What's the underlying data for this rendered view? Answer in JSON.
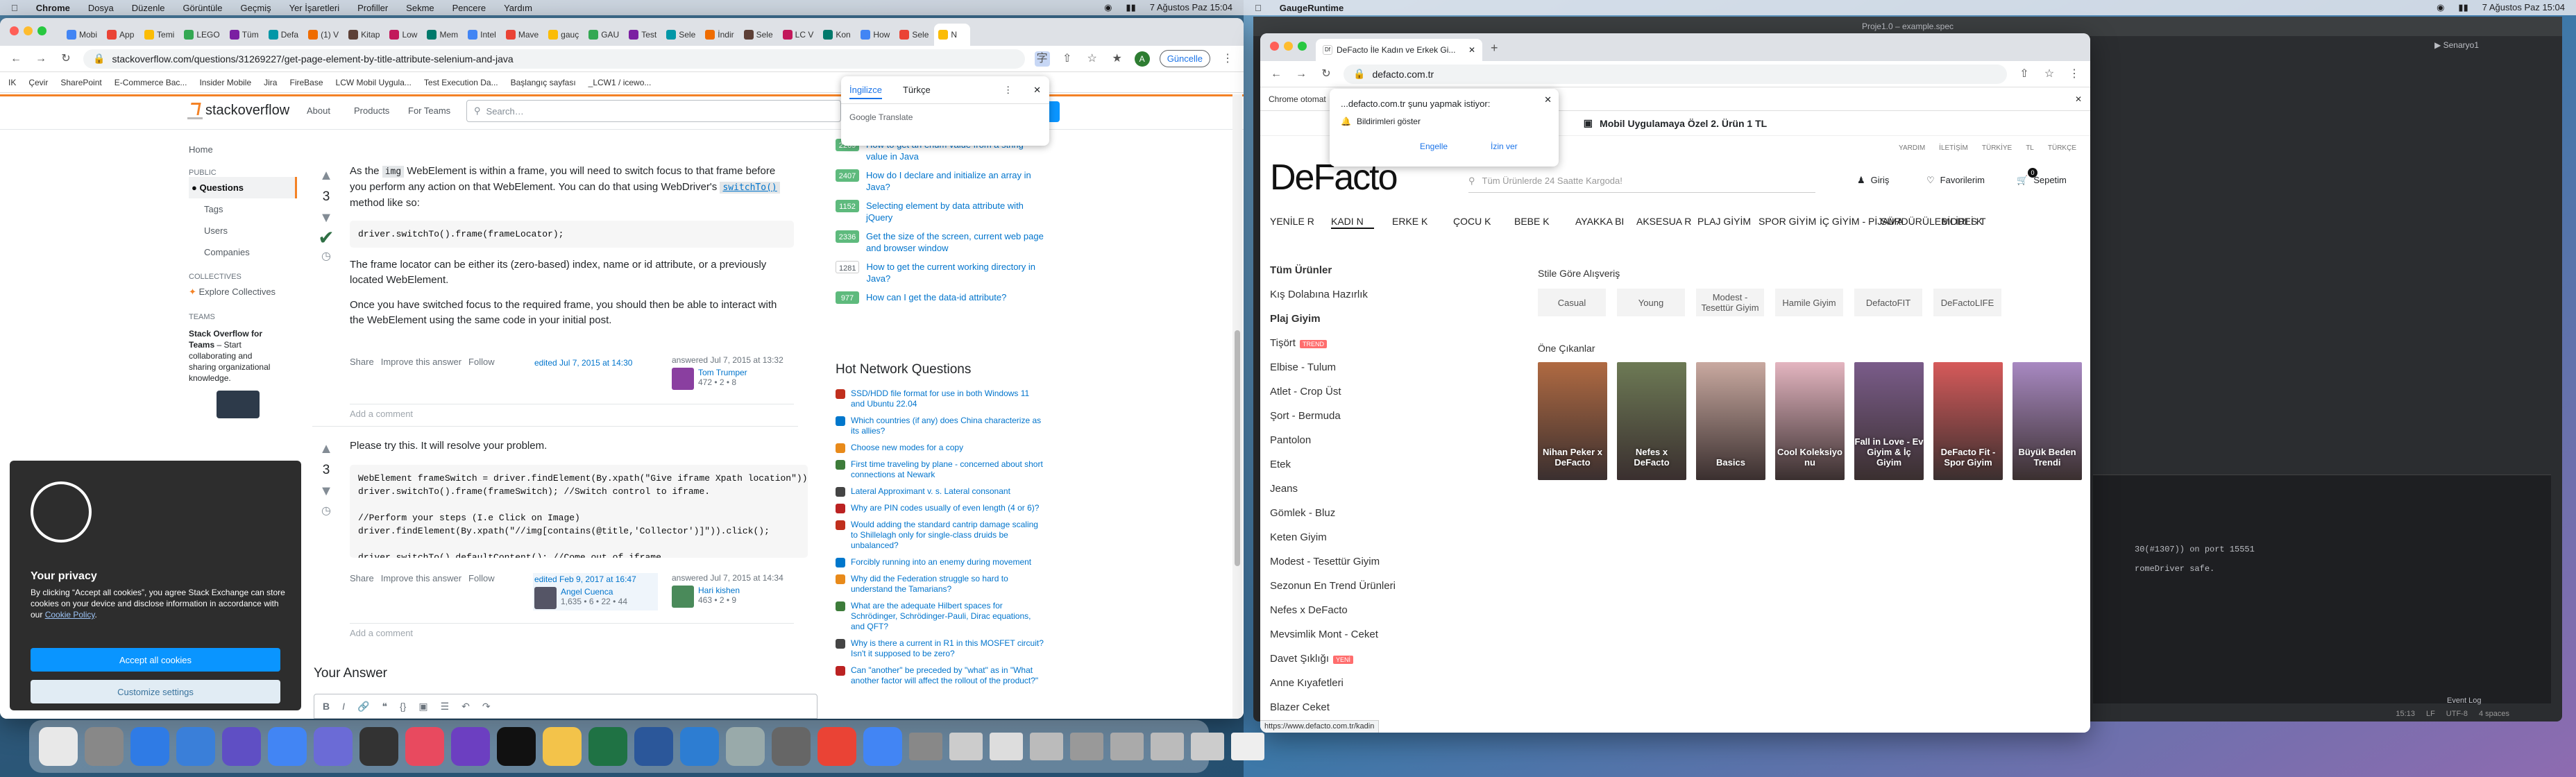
{
  "menubar_left": {
    "app": "Chrome",
    "items": [
      "Dosya",
      "Düzenle",
      "Görüntüle",
      "Geçmiş",
      "Yer İşaretleri",
      "Profiller",
      "Sekme",
      "Pencere",
      "Yardım"
    ],
    "datetime": "7 Ağustos Paz 15:04"
  },
  "menubar_right": {
    "app": "GaugeRuntime",
    "datetime": "7 Ağustos Paz 15:04"
  },
  "chrome_left": {
    "tabs": [
      "Mobi",
      "App",
      "Temi",
      "LEGO",
      "Tüm",
      "Defa",
      "(1) V",
      "Kitap",
      "Low",
      "Mem",
      "Intel",
      "Mave",
      "gauç",
      "GAU",
      "Test",
      "Sele",
      "İndir",
      "Sele",
      "LC V",
      "Kon",
      "How",
      "Sele",
      "N"
    ],
    "url": "stackoverflow.com/questions/31269227/get-page-element-by-title-attribute-selenium-and-java",
    "update_button": "Güncelle",
    "bookmarks": [
      "IK",
      "Çevir",
      "SharePoint",
      "E-Commerce Bac...",
      "Insider Mobile",
      "Jira",
      "FireBase",
      "LCW Mobil Uygula...",
      "Test Execution Da...",
      "Başlangıç sayfası",
      "_LCW1 / icewo..."
    ],
    "translate": {
      "lang1": "İngilizce",
      "lang2": "Türkçe",
      "brand": "Google Translate"
    }
  },
  "so": {
    "logo": "stackoverflow",
    "nav": [
      "About",
      "Products",
      "For Teams"
    ],
    "search_placeholder": "Search…",
    "sidebar": {
      "home": "Home",
      "public": "PUBLIC",
      "questions": "Questions",
      "tags": "Tags",
      "users": "Users",
      "companies": "Companies",
      "collectives": "COLLECTIVES",
      "explore": "Explore Collectives",
      "teams": "TEAMS",
      "teams_title": "Stack Overflow for Teams",
      "teams_text": " – Start collaborating and sharing organizational knowledge."
    },
    "answer1": {
      "votes": "3",
      "p1a": "As the ",
      "p1code": "img",
      "p1b": " WebElement is within a frame, you will need to switch focus to that frame before you perform any action on that WebElement. You can do that using WebDriver's ",
      "p1link": "switchTo()",
      "p1c": " method like so:",
      "code": "driver.switchTo().frame(frameLocator);",
      "p2": "The frame locator can be either its (zero-based) index, name or id attribute, or a previously located WebElement.",
      "p3": "Once you have switched focus to the required frame, you should then be able to interact with the WebElement using the same code in your initial post.",
      "actions": [
        "Share",
        "Improve this answer",
        "Follow"
      ],
      "edited": "edited Jul 7, 2015 at 14:30",
      "answered": "answered Jul 7, 2015 at 13:32",
      "user": "Tom Trumper",
      "rep": "472 • 2 • 8",
      "comment": "Add a comment"
    },
    "answer2": {
      "votes": "3",
      "p1": "Please try this. It will resolve your problem.",
      "code": "WebElement frameSwitch = driver.findElement(By.xpath(\"Give iframe Xpath location\"));\ndriver.switchTo().frame(frameSwitch); //Switch control to iframe.\n\n//Perform your steps (I.e Click on Image)\ndriver.findElement(By.xpath(\"//img[contains(@title,'Collector')]\")).click();\n\ndriver.switchTo().defaultContent(); //Come out of iframe.",
      "actions": [
        "Share",
        "Improve this answer",
        "Follow"
      ],
      "edited": "edited Feb 9, 2017 at 16:47",
      "editor": "Angel Cuenca",
      "editor_rep": "1,635 • 6 • 22 • 44",
      "answered": "answered Jul 7, 2015 at 14:34",
      "user": "Hari kishen",
      "rep": "463 • 2 • 9",
      "comment": "Add a comment"
    },
    "your_answer": "Your Answer",
    "related": [
      {
        "n": "2269",
        "t": "How to get an enum value from a string value in Java"
      },
      {
        "n": "2407",
        "t": "How do I declare and initialize an array in Java?"
      },
      {
        "n": "1152",
        "t": "Selecting element by data attribute with jQuery"
      },
      {
        "n": "2336",
        "t": "Get the size of the screen, current web page and browser window"
      },
      {
        "n": "1281",
        "t": "How to get the current working directory in Java?"
      },
      {
        "n": "977",
        "t": "How can I get the data-id attribute?"
      }
    ],
    "hnq_title": "Hot Network Questions",
    "hnq": [
      "SSD/HDD file format for use in both Windows 11 and Ubuntu 22.04",
      "Which countries (if any) does China characterize as its allies?",
      "Choose new modes for a copy",
      "First time traveling by plane - concerned about short connections at Newark",
      "Lateral Approximant v. s. Lateral consonant",
      "Why are PIN codes usually of even length (4 or 6)?",
      "Would adding the standard cantrip damage scaling to Shillelagh only for single-class druids be unbalanced?",
      "Forcibly running into an enemy during movement",
      "Why did the Federation struggle so hard to understand the Tamarians?",
      "What are the adequate Hilbert spaces for Schrödinger, Schrödinger-Pauli, Dirac equations, and QFT?",
      "Why is there a current in R1 in this MOSFET circuit? Isn't it supposed to be zero?",
      "Can \"another\" be preceded by \"what\" as in \"What another factor will affect the rollout of the product?\""
    ],
    "cookie": {
      "title": "Your privacy",
      "text_a": "By clicking “Accept all cookies”, you agree Stack Exchange can store cookies on your device and disclose information in accordance with our ",
      "link": "Cookie Policy",
      "accept": "Accept all cookies",
      "customize": "Customize settings"
    }
  },
  "chrome_right": {
    "tab": "DeFacto İle Kadın ve Erkek Gi...",
    "url": "defacto.com.tr",
    "notify_title": "...defacto.com.tr şunu yapmak istiyor:",
    "notify_text": "Bildirimleri göster",
    "notify_allow": "Engelle",
    "notify_block": "İzin ver",
    "chrome_note": "Chrome otomat",
    "status_url": "https://www.defacto.com.tr/kadin"
  },
  "defacto": {
    "promo": "Mobil Uygulamaya Özel 2. Ürün 1 TL",
    "toplinks": [
      "YARDIM",
      "İLETİŞİM",
      "TÜRKİYE",
      "TL",
      "TÜRKÇE"
    ],
    "logo": "DeFacto",
    "search_placeholder": "Tüm Ürünlerde 24 Saatte Kargoda!",
    "login": "Giriş",
    "fav": "Favorilerim",
    "cart": "Sepetim",
    "cart_count": "0",
    "nav": [
      "YENİLE R",
      "KADI N",
      "ERKE K",
      "ÇOCU K",
      "BEBE K",
      "AYAKKA BI",
      "AKSESUA R",
      "PLAJ GİYİM",
      "SPOR GİYİM",
      "İÇ GİYİM - PİJAMA",
      "SÜRDÜRÜLEBİLİRLİ K",
      "MODES T"
    ],
    "categories": [
      "Tüm Ürünler",
      "Kış Dolabına Hazırlık",
      "Plaj Giyim",
      "Tişört",
      "Elbise - Tulum",
      "Atlet - Crop Üst",
      "Şort - Bermuda",
      "Pantolon",
      "Etek",
      "Jeans",
      "Gömlek - Bluz",
      "Keten Giyim",
      "Modest - Tesettür Giyim",
      "Sezonun En Trend Ürünleri",
      "Nefes x DeFacto",
      "Mevsimlik Mont - Ceket",
      "Davet Şıklığı",
      "Anne Kıyafetleri",
      "Blazer Ceket"
    ],
    "badge_new": "TREND",
    "badge_new2": "YENİ",
    "style_title": "Stile Göre Alışveriş",
    "styles": [
      "Casual",
      "Young",
      "Modest - Tesettür Giyim",
      "Hamile Giyim",
      "DefactoFIT",
      "DeFactoLIFE"
    ],
    "featured_title": "Öne Çıkanlar",
    "featured": [
      "Nihan Peker x DeFacto",
      "Nefes x DeFacto",
      "Basics",
      "Cool Koleksiyo nu",
      "Fall in Love - Ev Giyim & İç Giyim",
      "DeFacto Fit - Spor Giyim",
      "Büyük Beden Trendi"
    ]
  },
  "ide": {
    "title": "Proje1.0 – example.spec",
    "config": "Senaryo1",
    "log1": "30(#1307)) on port 15551",
    "log2": "romeDriver safe.",
    "status": [
      "15:13",
      "LF",
      "UTF-8",
      "4 spaces"
    ],
    "event_log": "Event Log"
  },
  "colors": {
    "so_orange": "#f48225",
    "so_blue": "#0a95ff",
    "so_green": "#2f6f44",
    "df_red": "#ff3838"
  }
}
